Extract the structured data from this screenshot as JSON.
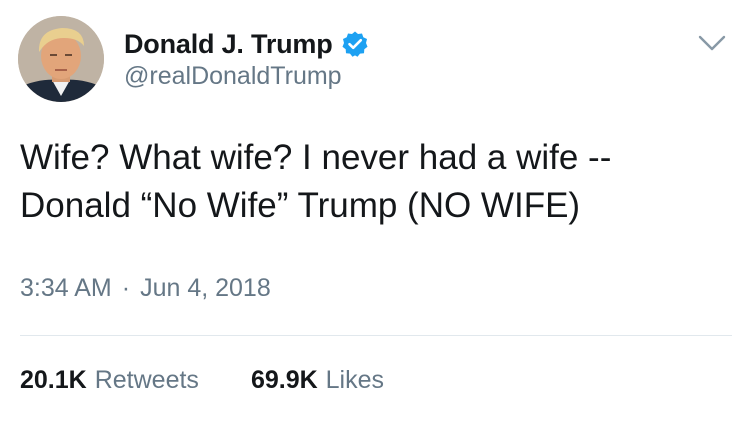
{
  "author": {
    "display_name": "Donald J. Trump",
    "handle": "@realDonaldTrump",
    "verified_icon": "verified-badge-icon",
    "avatar_icon": "profile-photo"
  },
  "menu": {
    "icon": "chevron-down-icon"
  },
  "tweet": {
    "text_line_1": "Wife? What wife? I never had a wife --",
    "text_line_2": "Donald “No Wife” Trump (NO WIFE)"
  },
  "meta": {
    "time": "3:34 AM",
    "separator": "·",
    "date": "Jun 4, 2018"
  },
  "stats": {
    "retweets_count": "20.1K",
    "retweets_label": "Retweets",
    "likes_count": "69.9K",
    "likes_label": "Likes"
  },
  "colors": {
    "text": "#14171a",
    "secondary": "#657786",
    "verified": "#1da1f2",
    "divider": "#e1e8ed"
  }
}
